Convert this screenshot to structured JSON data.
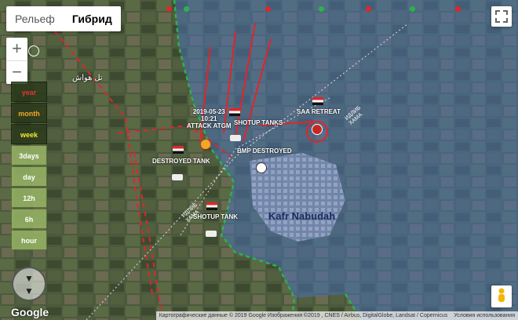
{
  "map_type": {
    "relief": "Рельеф",
    "hybrid": "Гибрид",
    "selected": "hybrid"
  },
  "zoom": {
    "in": "+",
    "out": "−"
  },
  "timebar": [
    {
      "label": "year",
      "style": "dark",
      "tone": "red"
    },
    {
      "label": "month",
      "style": "dark",
      "tone": "orange"
    },
    {
      "label": "week",
      "style": "dark",
      "tone": "yellow"
    },
    {
      "label": "3days",
      "style": "light",
      "tone": "white"
    },
    {
      "label": "day",
      "style": "light",
      "tone": "white"
    },
    {
      "label": "12h",
      "style": "light",
      "tone": "white"
    },
    {
      "label": "6h",
      "style": "light",
      "tone": "white"
    },
    {
      "label": "hour",
      "style": "light",
      "tone": "white"
    }
  ],
  "map_labels": {
    "arabic_place": "تل هواش",
    "kafr_nabudah": "Kafr Nabudah",
    "road_left": "ИДЛИБ ХАМА",
    "road_right": "ИДЛИБ ХАМА"
  },
  "events": {
    "saa_retreat": "SAA RETREAT",
    "shotup_tanks": "SHOTUP TANKS",
    "bmp_destroyed": "BMP DESTROYED",
    "destroyed_tank": "DESTROYED TANK",
    "shotup_tank": "SHOTUP TANK",
    "attack_atgm": "ATTACK ATGM",
    "event_date": "2019-05-23",
    "event_time": "10:21"
  },
  "attribution": {
    "data": "Картографические данные © 2019 Google Изображения ©2019 , CNES / Airbus, DigitalGlobe, Landsat / Copernicus",
    "terms": "Условия использования"
  },
  "google_logo": "Google",
  "colors": {
    "government_zone": "#4a6fb5",
    "front_line_green": "#2bb34a",
    "attack_red": "#e0252b"
  }
}
